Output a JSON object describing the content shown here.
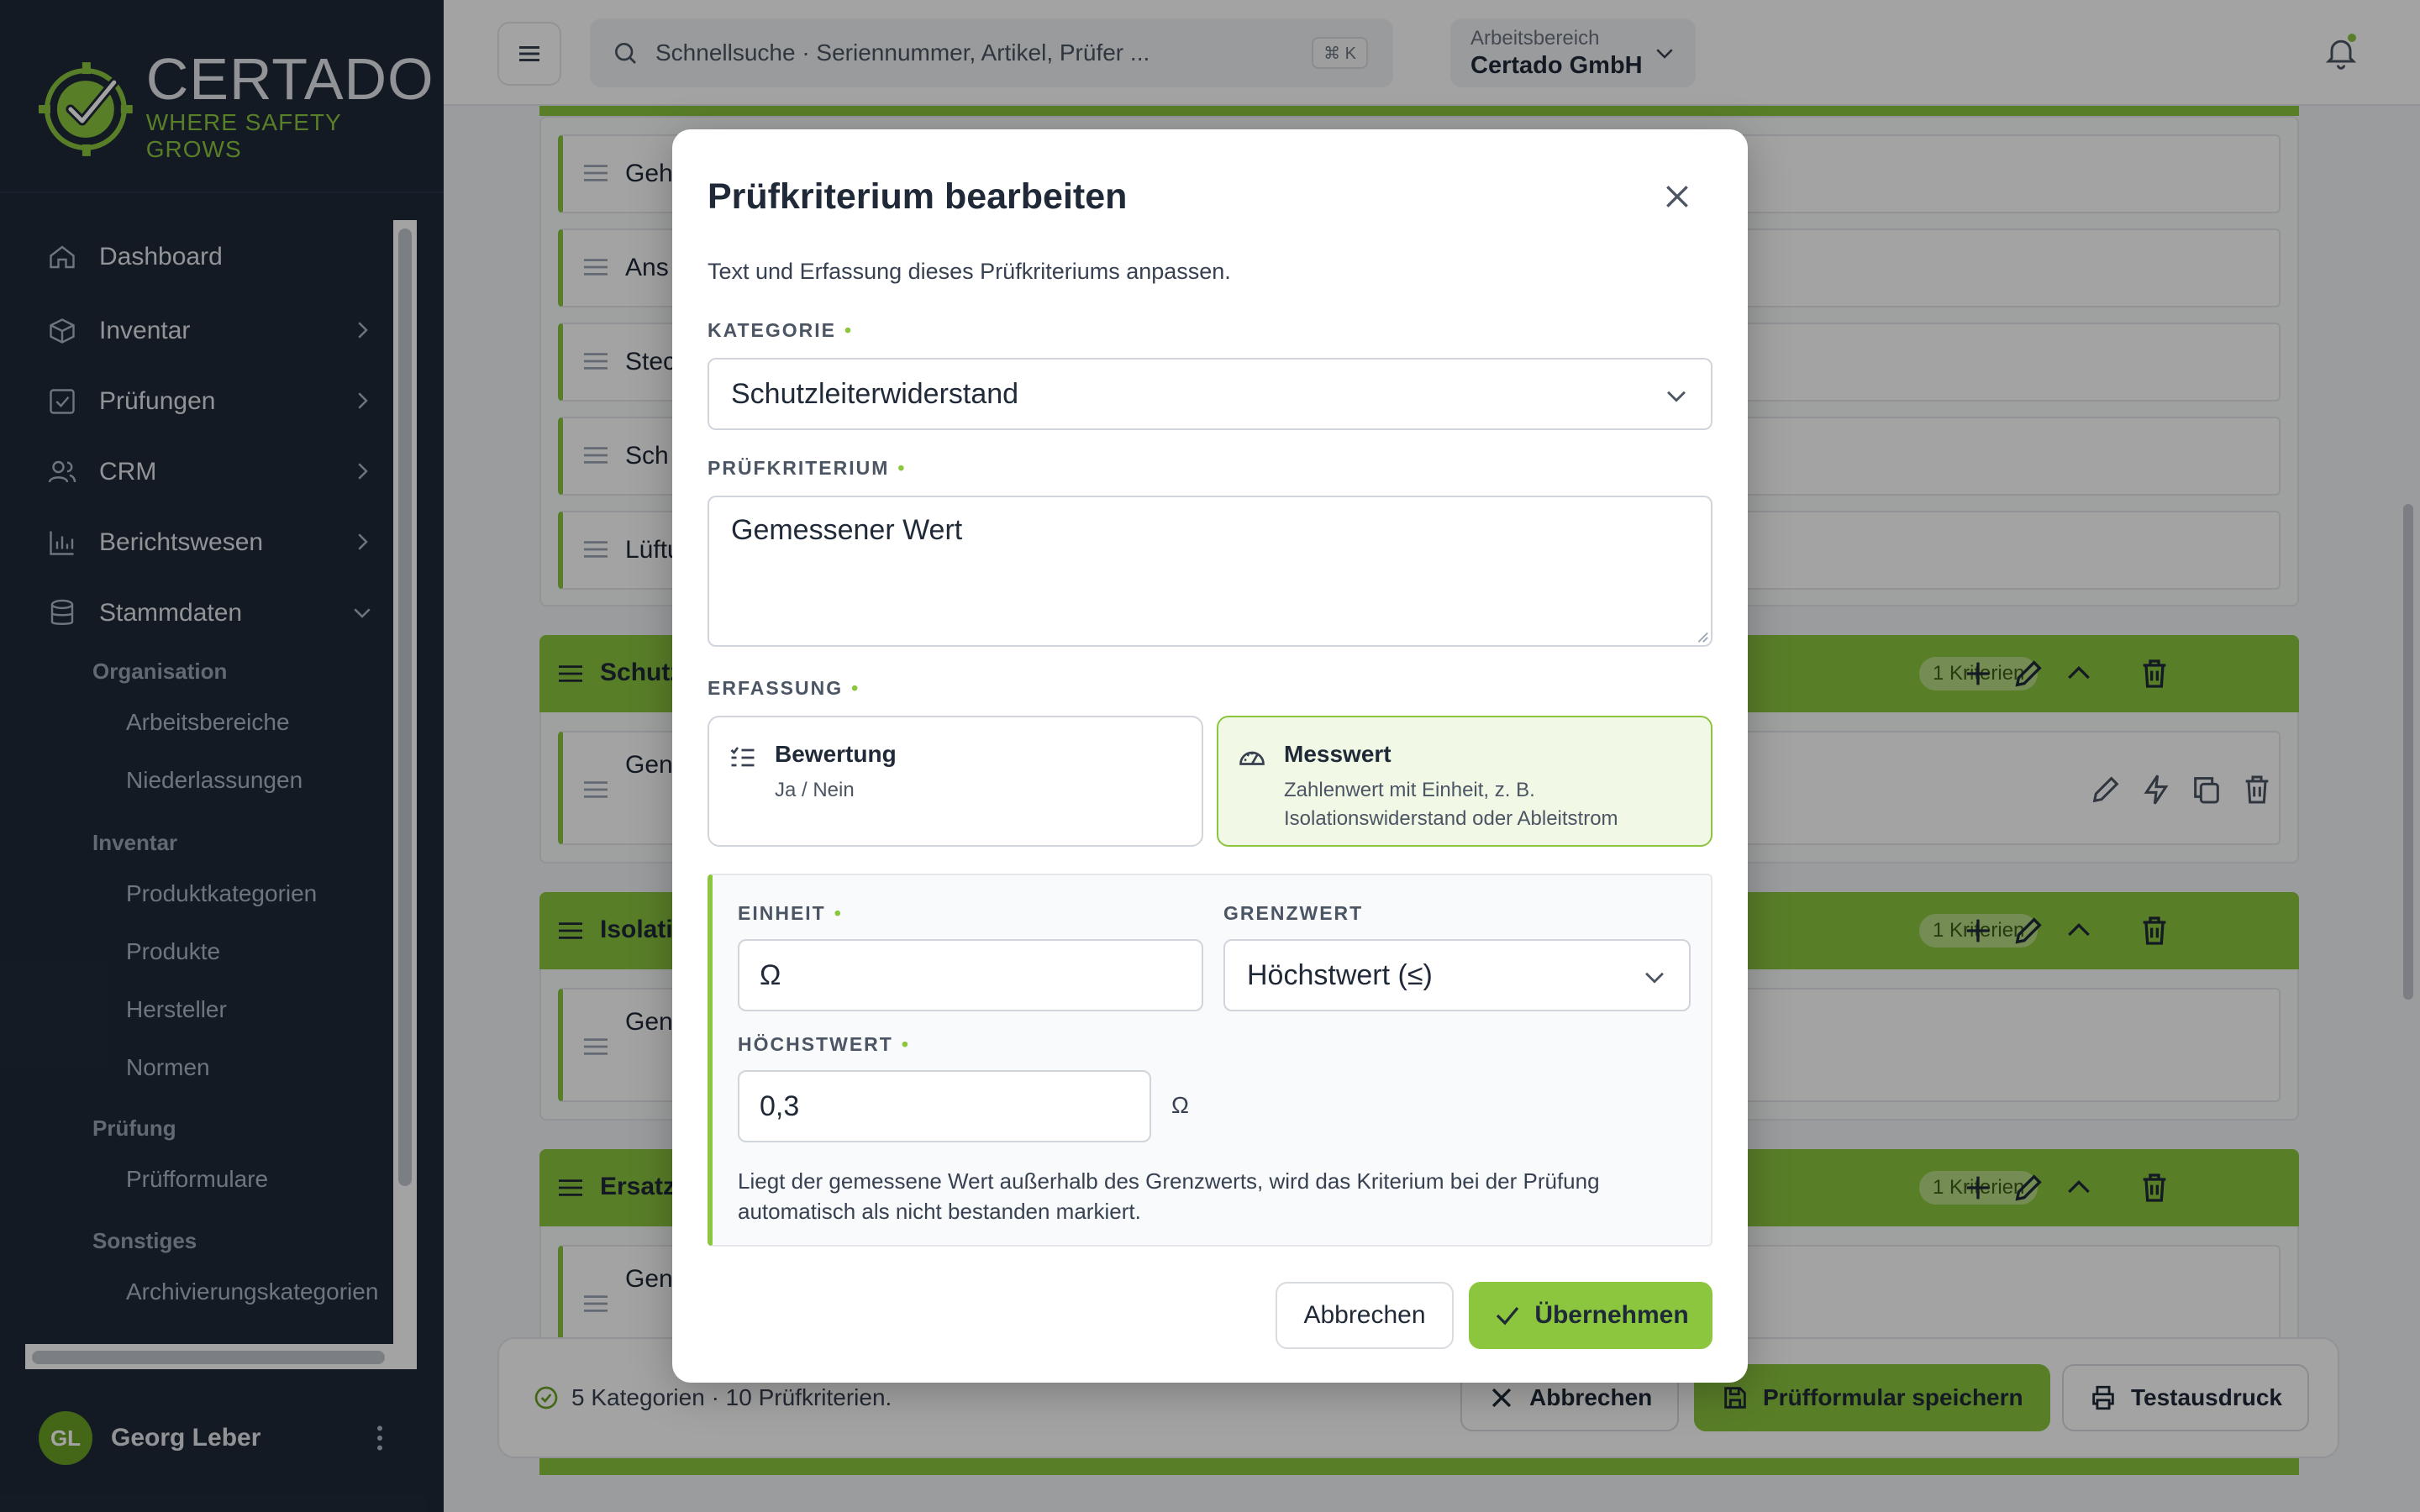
{
  "brand": {
    "name": "CERTADO",
    "tagline": "WHERE SAFETY GROWS",
    "accent": "#8cc63f",
    "sidebar_bg": "#1e2a38"
  },
  "sidebar": {
    "nav": [
      {
        "label": "Dashboard",
        "icon": "home-icon"
      },
      {
        "label": "Inventar",
        "icon": "box-icon"
      },
      {
        "label": "Prüfungen",
        "icon": "checkbox-icon"
      },
      {
        "label": "CRM",
        "icon": "users-icon"
      },
      {
        "label": "Berichtswesen",
        "icon": "bar-chart-icon"
      },
      {
        "label": "Stammdaten",
        "icon": "database-icon"
      }
    ],
    "groups": {
      "organisation": {
        "title": "Organisation",
        "items": [
          "Arbeitsbereiche",
          "Niederlassungen"
        ]
      },
      "inventar": {
        "title": "Inventar",
        "items": [
          "Produktkategorien",
          "Produkte",
          "Hersteller",
          "Normen"
        ]
      },
      "pruefung": {
        "title": "Prüfung",
        "items": [
          "Prüfformulare"
        ]
      },
      "sonstiges": {
        "title": "Sonstiges",
        "items": [
          "Archivierungskategorien"
        ]
      }
    },
    "user": {
      "initials": "GL",
      "name": "Georg Leber"
    }
  },
  "topbar": {
    "search_placeholder": "Schnellsuche · Seriennummer, Artikel, Prüfer ...",
    "shortcut": "⌘ K",
    "workspace_label": "Arbeitsbereich",
    "workspace_value": "Certado GmbH"
  },
  "background": {
    "rows_top": [
      "Geh",
      "Ans",
      "Stec",
      "Sch",
      "Lüftu"
    ],
    "categories": [
      {
        "title": "Schutz",
        "badge": "1 Kriterien",
        "row": "Gen"
      },
      {
        "title": "Isolati",
        "badge": "1 Kriterien",
        "row": "Gen"
      },
      {
        "title": "Ersatz",
        "badge": "1 Kriterien",
        "row": "Gen"
      }
    ],
    "footer_status": "5 Kategorien · 10 Prüfkriterien.",
    "footer_cancel": "Abbrechen",
    "footer_save": "Prüfformular speichern",
    "footer_print": "Testausdruck"
  },
  "modal": {
    "title": "Prüfkriterium bearbeiten",
    "description": "Text und Erfassung dieses Prüfkriteriums anpassen.",
    "category_label": "KATEGORIE",
    "category_value": "Schutzleiterwiderstand",
    "criterion_label": "PRÜFKRITERIUM",
    "criterion_value": "Gemessener Wert",
    "capture_label": "ERFASSUNG",
    "options": [
      {
        "title": "Bewertung",
        "subtitle": "Ja / Nein",
        "icon": "list-check-icon",
        "selected": false
      },
      {
        "title": "Messwert",
        "subtitle": "Zahlenwert mit Einheit, z. B. Isolationswiderstand oder Ableitstrom",
        "icon": "gauge-icon",
        "selected": true
      }
    ],
    "unit_label": "EINHEIT",
    "unit_value": "Ω",
    "limit_label": "GRENZWERT",
    "limit_value": "Höchstwert (≤)",
    "max_label": "HÖCHSTWERT",
    "max_value": "0,3",
    "max_unit": "Ω",
    "hint": "Liegt der gemessene Wert außerhalb des Grenzwerts, wird das Kriterium bei der Prüfung automatisch als nicht bestanden markiert.",
    "cancel_label": "Abbrechen",
    "apply_label": "Übernehmen"
  }
}
